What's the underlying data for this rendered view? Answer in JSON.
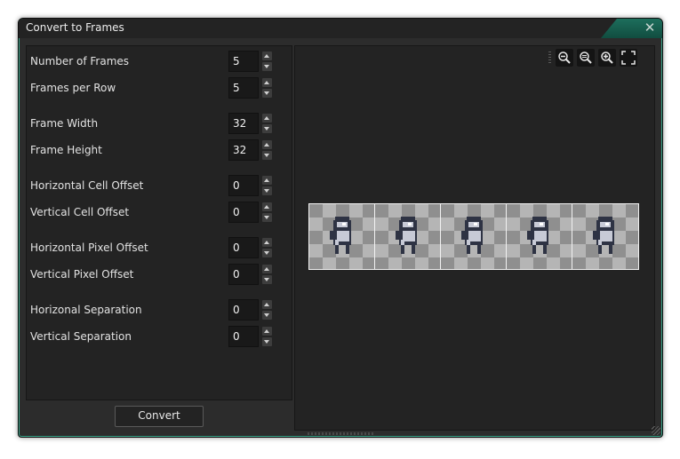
{
  "window": {
    "title": "Convert to Frames",
    "close_glyph": "✕"
  },
  "fields": [
    {
      "label": "Number of Frames",
      "value": "5"
    },
    {
      "label": "Frames per Row",
      "value": "5"
    },
    {
      "label": "Frame Width",
      "value": "32"
    },
    {
      "label": "Frame Height",
      "value": "32"
    },
    {
      "label": "Horizontal Cell Offset",
      "value": "0"
    },
    {
      "label": "Vertical Cell Offset",
      "value": "0"
    },
    {
      "label": "Horizontal Pixel Offset",
      "value": "0"
    },
    {
      "label": "Vertical Pixel Offset",
      "value": "0"
    },
    {
      "label": "Horizonal Separation",
      "value": "0"
    },
    {
      "label": "Vertical Separation",
      "value": "0"
    }
  ],
  "convert_button": "Convert",
  "preview": {
    "toolbar_icons": [
      "zoom-out-icon",
      "zoom-reset-icon",
      "zoom-in-icon",
      "fit-screen-icon"
    ],
    "frame_count": 5
  },
  "colors": {
    "title_accent": "#1d6e5c",
    "panel_bg": "#232323"
  }
}
